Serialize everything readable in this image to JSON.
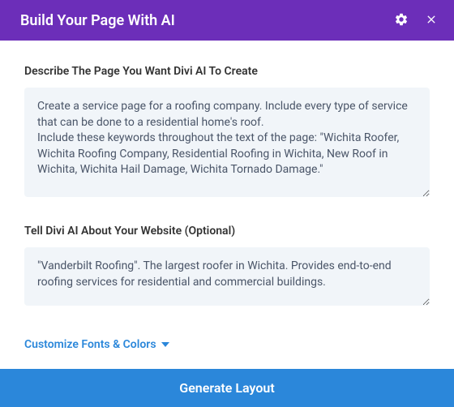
{
  "header": {
    "title": "Build Your Page With AI"
  },
  "form": {
    "describe": {
      "label": "Describe The Page You Want Divi AI To Create",
      "value": "Create a service page for a roofing company. Include every type of service that can be done to a residential home's roof.\nInclude these keywords throughout the text of the page: \"Wichita Roofer, Wichita Roofing Company, Residential Roofing in Wichita, New Roof in Wichita, Wichita Hail Damage, Wichita Tornado Damage.\""
    },
    "about": {
      "label": "Tell Divi AI About Your Website (Optional)",
      "value": "\"Vanderbilt Roofing\". The largest roofer in Wichita. Provides end-to-end roofing services for residential and commercial buildings."
    },
    "customize_link": "Customize Fonts & Colors"
  },
  "footer": {
    "generate_label": "Generate Layout"
  }
}
